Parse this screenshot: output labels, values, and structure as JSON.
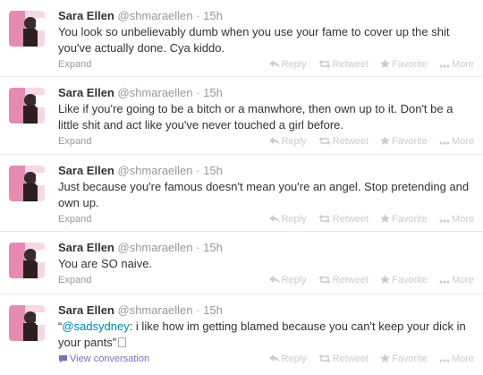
{
  "tweets": [
    {
      "fullname": "Sara Ellen",
      "username": "@shmaraellen",
      "sep": "·",
      "time": "15h",
      "text": "You look so unbelievably dumb when you use your fame to cover up the shit you've actually done. Cya kiddo.",
      "footer_link": "Expand"
    },
    {
      "fullname": "Sara Ellen",
      "username": "@shmaraellen",
      "sep": "·",
      "time": "15h",
      "text": "Like if you're going to be a bitch or a manwhore, then own up to it. Don't be a little shit and act like you've never touched a girl before.",
      "footer_link": "Expand"
    },
    {
      "fullname": "Sara Ellen",
      "username": "@shmaraellen",
      "sep": "·",
      "time": "15h",
      "text": "Just because you're famous doesn't mean you're an angel. Stop pretending and own up.",
      "footer_link": "Expand"
    },
    {
      "fullname": "Sara Ellen",
      "username": "@shmaraellen",
      "sep": "·",
      "time": "15h",
      "text": "You are SO naive.",
      "footer_link": "Expand"
    },
    {
      "fullname": "Sara Ellen",
      "username": "@shmaraellen",
      "sep": "·",
      "time": "15h",
      "text_open_quote": "“",
      "mention": "@sadsydney",
      "text_rest": ": i like how im getting blamed because you can't keep your dick in your pants”",
      "footer_link": "View conversation"
    }
  ],
  "actions": {
    "reply": "Reply",
    "retweet": "Retweet",
    "favorite": "Favorite",
    "more": "More"
  },
  "icons": {
    "reply": "reply-arrow-icon",
    "retweet": "retweet-icon",
    "favorite": "star-icon",
    "more": "ellipsis-icon",
    "conversation": "speech-bubble-icon"
  },
  "colors": {
    "link": "#0084b4",
    "conversation": "#7f6bbf",
    "muted": "#999999",
    "action": "#cccccc"
  }
}
